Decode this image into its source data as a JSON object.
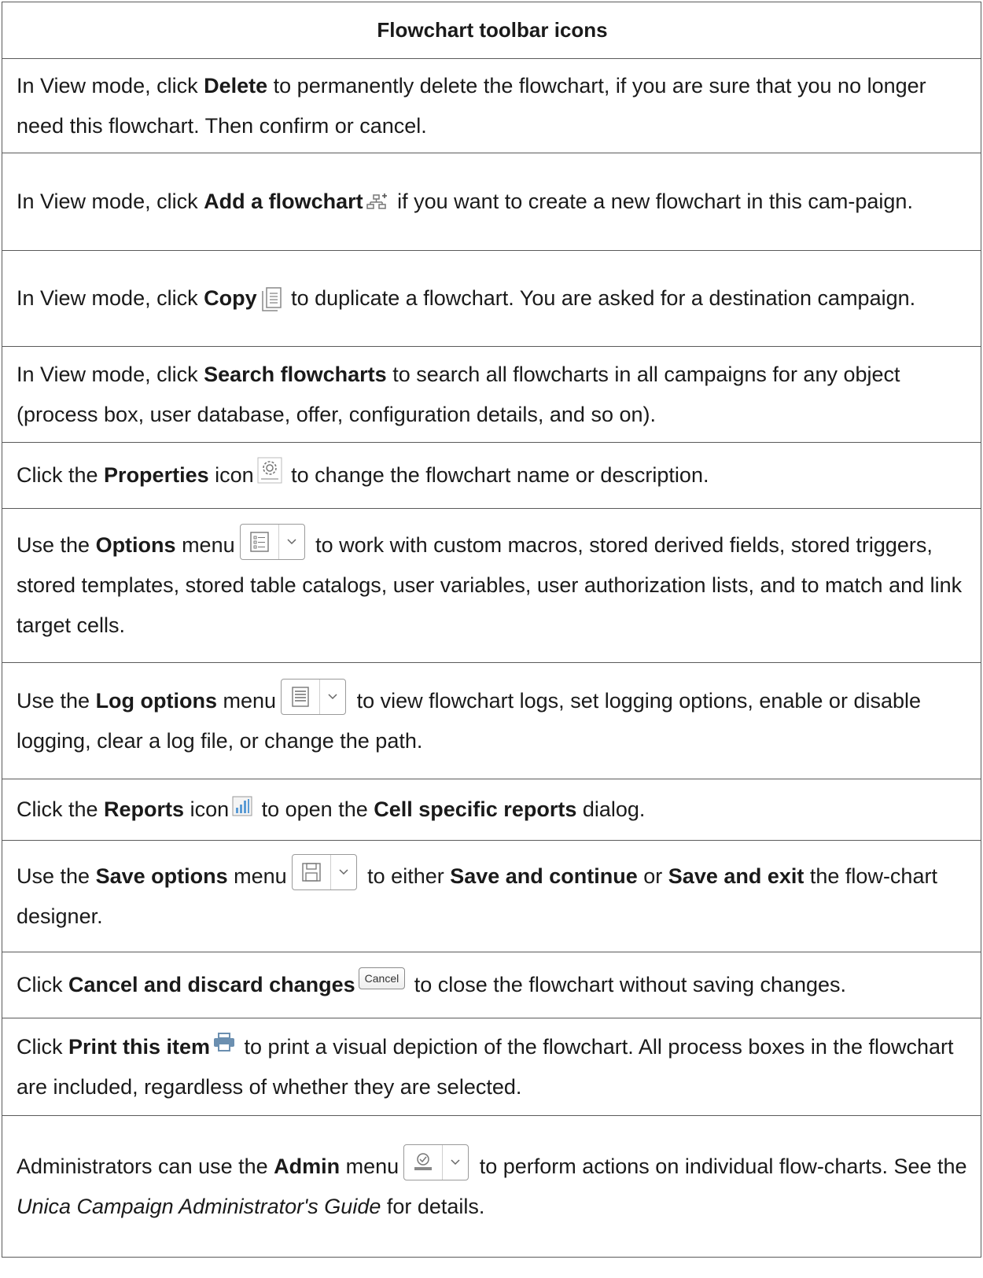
{
  "table": {
    "header": "Flowchart toolbar icons",
    "rows": [
      {
        "p1": "In View mode, click ",
        "b1": "Delete",
        "p2": " to permanently delete the flowchart, if you are sure that you no longer need this flowchart. Then confirm or cancel."
      },
      {
        "p1": "In View mode, click ",
        "b1": "Add a flowchart",
        "p2": " if you want to create a new flowchart in this cam-paign.",
        "icon": "add-flowchart-icon"
      },
      {
        "p1": "In View mode, click ",
        "b1": "Copy",
        "p2": " to duplicate a flowchart. You are asked for a destination campaign.",
        "icon": "copy-icon"
      },
      {
        "p1": "In View mode, click ",
        "b1": "Search flowcharts",
        "p2": " to search all flowcharts in all campaigns for any object (process box, user database, offer, configuration details, and so on)."
      },
      {
        "p1": "Click the ",
        "b1": "Properties",
        "p2": " icon",
        "p3": " to change the flowchart name or description.",
        "icon": "properties-gear-icon"
      },
      {
        "p1": "Use the ",
        "b1": "Options",
        "p2": " menu",
        "p3": " to work with custom macros, stored derived fields, stored triggers, stored templates, stored table catalogs, user variables, user authorization lists, and to match and link target cells.",
        "icon": "options-menu-icon"
      },
      {
        "p1": "Use the ",
        "b1": "Log options",
        "p2": " menu",
        "p3": " to view flowchart logs, set logging options, enable or disable logging, clear a log file, or change the path.",
        "icon": "log-options-icon"
      },
      {
        "p1": "Click the ",
        "b1": "Reports",
        "p2": " icon",
        "p3": " to open the ",
        "b2": "Cell specific reports",
        "p4": " dialog.",
        "icon": "reports-icon"
      },
      {
        "p1": "Use the ",
        "b1": "Save options",
        "p2": " menu",
        "p3": " to either ",
        "b2": "Save and continue",
        "p4": " or ",
        "b3": "Save and exit",
        "p5": " the flow-chart designer.",
        "icon": "save-options-icon"
      },
      {
        "p1": "Click ",
        "b1": "Cancel and discard changes",
        "p2": " to close the flowchart without saving changes.",
        "button": "Cancel"
      },
      {
        "p1": "Click ",
        "b1": "Print this item",
        "p2": " to print a visual depiction of the flowchart. All process boxes in the flowchart are included, regardless of whether they are selected.",
        "icon": "print-icon"
      },
      {
        "p1": "Administrators can use the ",
        "b1": "Admin",
        "p2": " menu",
        "p3": " to perform actions on individual flow-charts. See the ",
        "i1": "Unica Campaign Administrator's Guide",
        "p4": " for details.",
        "icon": "admin-menu-icon"
      }
    ]
  }
}
